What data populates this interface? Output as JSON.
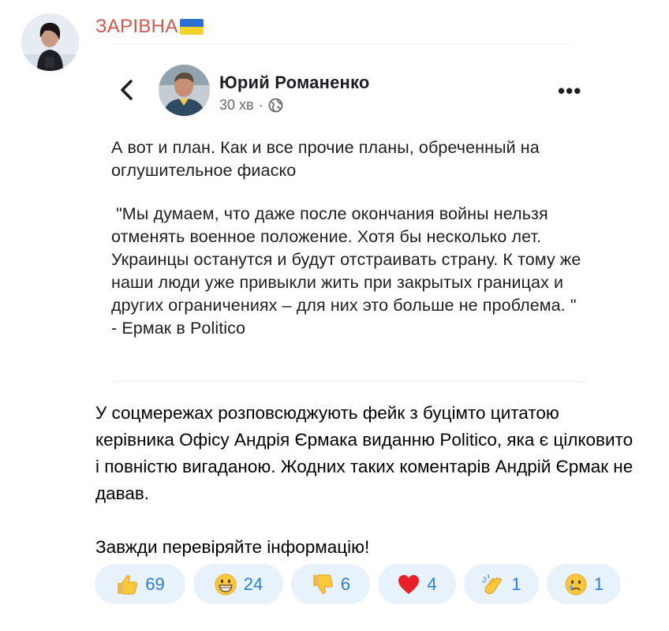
{
  "channel": {
    "name": "ЗАРІВНА",
    "avatar": "avatar"
  },
  "embedded_post": {
    "author": "Юрий Романенко",
    "time": "30 хв",
    "separator": "·",
    "privacy_icon": "globe-icon",
    "intro": "А вот и план. Как и все прочие планы, обреченный на оглушительное фиаско",
    "quote": " \"Мы думаем, что даже после окончания войны нельзя отменять военное положение. Хотя бы несколько лет. Украинцы останутся и будут отстраивать страну. К тому же наши люди уже привыкли жить при закрытых границах и других ограничениях – для них это больше не проблема. \" - Ермак в Politico"
  },
  "message": {
    "paragraph1": "У соцмережах розповсюджують фейк з буцімто цитатою керівника Офісу Андрія Єрмака виданню Politico, яка є цілковито і повністю вигаданою. Жодних таких коментарів Андрій Єрмак не давав.",
    "paragraph2": "Завжди перевіряйте інформацію!"
  },
  "reactions": [
    {
      "icon": "thumbs-up-icon",
      "count": "69"
    },
    {
      "icon": "grinning-face-icon",
      "count": "24"
    },
    {
      "icon": "thumbs-down-icon",
      "count": "6"
    },
    {
      "icon": "red-heart-icon",
      "count": "4"
    },
    {
      "icon": "clapping-hands-icon",
      "count": "1"
    },
    {
      "icon": "crying-face-icon",
      "count": "1"
    }
  ],
  "colors": {
    "channel_name": "#d0574f",
    "reaction_bg": "#e8f2fc",
    "reaction_text": "#2a7fd4"
  }
}
